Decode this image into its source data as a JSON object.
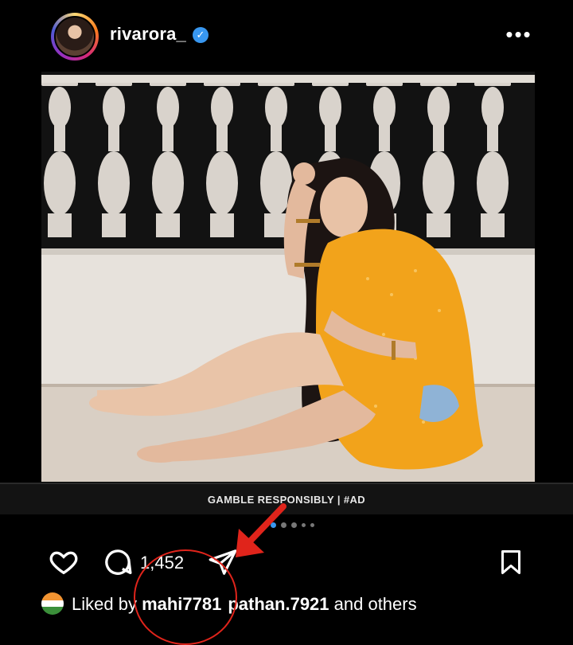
{
  "post": {
    "username": "rivarora_",
    "verified": true,
    "more_icon": "more-horizontal-icon",
    "ad_banner_text": "GAMBLE RESPONSIBLY  |  #AD",
    "carousel": {
      "count": 5,
      "active_index": 0
    }
  },
  "actions": {
    "comment_count": "1,452",
    "icons": [
      "heart-icon",
      "comment-icon",
      "send-icon",
      "bookmark-icon"
    ]
  },
  "likes": {
    "prefix": "Liked by ",
    "user1": "mahi7781",
    "user2": "pathan.7921",
    "suffix": " and others"
  },
  "annotation": {
    "color": "#e0241b"
  },
  "colors": {
    "background": "#000000",
    "verified": "#3897f0",
    "annotation": "#e0241b"
  }
}
